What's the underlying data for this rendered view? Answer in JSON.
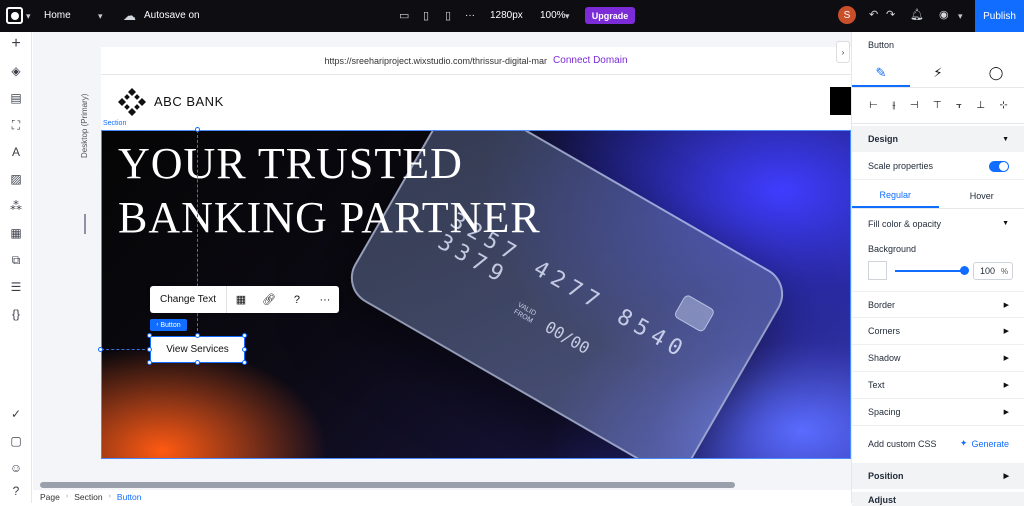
{
  "topbar": {
    "page_selector": "Home",
    "autosave": "Autosave on",
    "width_label": "1280px",
    "zoom_label": "100%",
    "more": "···",
    "upgrade": "Upgrade",
    "avatar_initial": "S",
    "publish": "Publish"
  },
  "canvas": {
    "desktop_label": "Desktop (Primary)",
    "url": "https://sreehariproject.wixstudio.com/thrissur-digital-mar",
    "connect_domain": "Connect Domain",
    "brand_name": "ABC BANK",
    "section_label": "Section",
    "hero_title_line1": "YOUR TRUSTED",
    "hero_title_line2": "BANKING PARTNER",
    "card_number": "3257 4277 8540 3379",
    "card_valid": "VALID\nFROM",
    "card_expiry": "00/00",
    "toolbar_change_text": "Change Text",
    "button_tag": "Button",
    "view_services": "View Services",
    "collapse_arrow": "›"
  },
  "breadcrumbs": [
    "Page",
    "Section",
    "Button"
  ],
  "panel": {
    "title": "Button",
    "design_header": "Design",
    "scale_properties": "Scale properties",
    "state_tabs": [
      "Regular",
      "Hover"
    ],
    "fill_color": "Fill color & opacity",
    "background_label": "Background",
    "opacity_value": "100",
    "opacity_unit": "%",
    "rows": [
      "Border",
      "Corners",
      "Shadow",
      "Text",
      "Spacing"
    ],
    "custom_css": "Add custom CSS",
    "generate": "Generate",
    "position_header": "Position",
    "adjust_header": "Adjust"
  },
  "colors": {
    "accent_blue": "#116dff",
    "upgrade_purple": "#7b2cd7",
    "topbar_bg": "#0d0d12"
  }
}
